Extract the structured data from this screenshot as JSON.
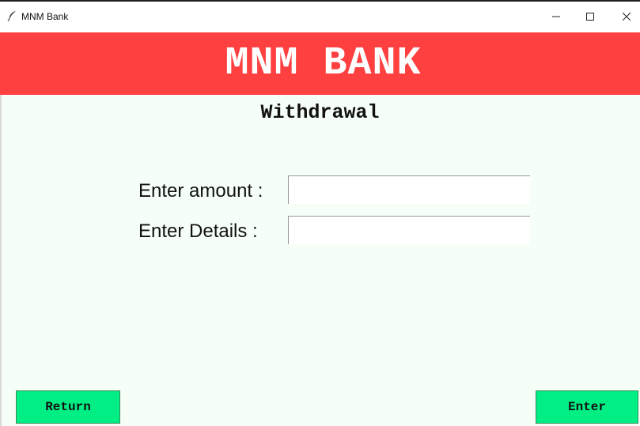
{
  "window": {
    "title": "MNM Bank",
    "icon": "feather-icon",
    "controls": {
      "minimize_icon": "minimize-icon",
      "maximize_icon": "maximize-icon",
      "close_icon": "close-icon"
    }
  },
  "banner": {
    "text": "MNM BANK",
    "color": "#ff4040"
  },
  "page": {
    "title": "Withdrawal",
    "background": "#f6fff7"
  },
  "form": {
    "amount": {
      "label": "Enter amount :",
      "value": ""
    },
    "details": {
      "label": "Enter Details :",
      "value": ""
    }
  },
  "actions": {
    "return_label": "Return",
    "enter_label": "Enter",
    "button_color": "#00ee83"
  }
}
